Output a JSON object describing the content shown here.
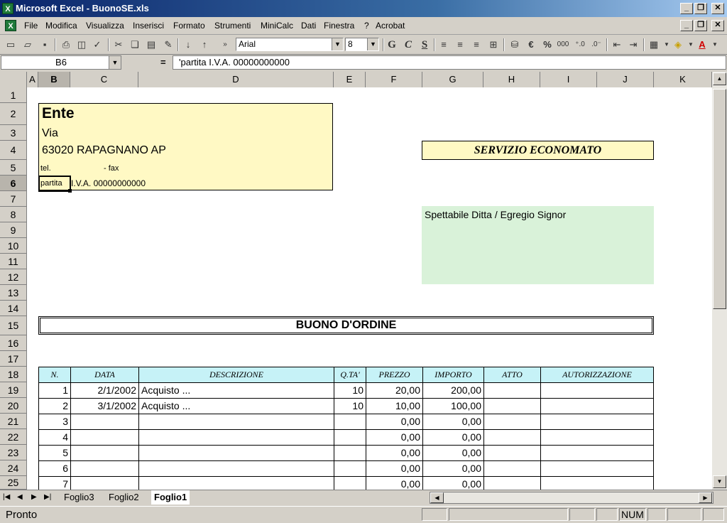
{
  "window": {
    "title": "Microsoft Excel - BuonoSE.xls",
    "app_icon": "excel-icon"
  },
  "menu": [
    "File",
    "Modifica",
    "Visualizza",
    "Inserisci",
    "Formato",
    "Strumenti",
    "MiniCalc",
    "Dati",
    "Finestra",
    "?",
    "Acrobat"
  ],
  "toolbar": {
    "font_name": "Arial",
    "font_size": "8",
    "bold": "G",
    "italic": "C",
    "underline": "S",
    "euro": "€",
    "percent": "%",
    "thousands": "000"
  },
  "formula_bar": {
    "cell_ref": "B6",
    "equals": "=",
    "content": "'partita I.V.A. 00000000000"
  },
  "columns": [
    "A",
    "B",
    "C",
    "D",
    "E",
    "F",
    "G",
    "H",
    "I",
    "J",
    "K"
  ],
  "rows": [
    "1",
    "2",
    "3",
    "4",
    "5",
    "6",
    "7",
    "8",
    "9",
    "10",
    "11",
    "12",
    "13",
    "14",
    "15",
    "16",
    "17",
    "18",
    "19",
    "20",
    "21",
    "22",
    "23",
    "24",
    "25"
  ],
  "header_block": {
    "ente": "Ente",
    "via": "Via",
    "city": "63020 RAPAGNANO AP",
    "tel": "tel.",
    "fax": "- fax",
    "piva_label": "partita",
    "piva_value": "I.V.A. 00000000000"
  },
  "servizio": "SERVIZIO ECONOMATO",
  "recipient": "Spettabile Ditta  / Egregio Signor",
  "doc_title": "BUONO D'ORDINE",
  "table": {
    "headers": [
      "N.",
      "DATA",
      "DESCRIZIONE",
      "Q.TA'",
      "PREZZO",
      "IMPORTO",
      "ATTO",
      "AUTORIZZAZIONE"
    ],
    "rows": [
      [
        "1",
        "2/1/2002",
        "Acquisto ...",
        "10",
        "20,00",
        "200,00",
        "",
        ""
      ],
      [
        "2",
        "3/1/2002",
        "Acquisto ...",
        "10",
        "10,00",
        "100,00",
        "",
        ""
      ],
      [
        "3",
        "",
        "",
        "",
        "0,00",
        "0,00",
        "",
        ""
      ],
      [
        "4",
        "",
        "",
        "",
        "0,00",
        "0,00",
        "",
        ""
      ],
      [
        "5",
        "",
        "",
        "",
        "0,00",
        "0,00",
        "",
        ""
      ],
      [
        "6",
        "",
        "",
        "",
        "0,00",
        "0,00",
        "",
        ""
      ],
      [
        "7",
        "",
        "",
        "",
        "0,00",
        "0,00",
        "",
        ""
      ]
    ]
  },
  "sheet_tabs": [
    "Foglio3",
    "Foglio2",
    "Foglio1"
  ],
  "active_sheet": "Foglio1",
  "status": {
    "mode": "Pronto",
    "num": "NUM"
  }
}
